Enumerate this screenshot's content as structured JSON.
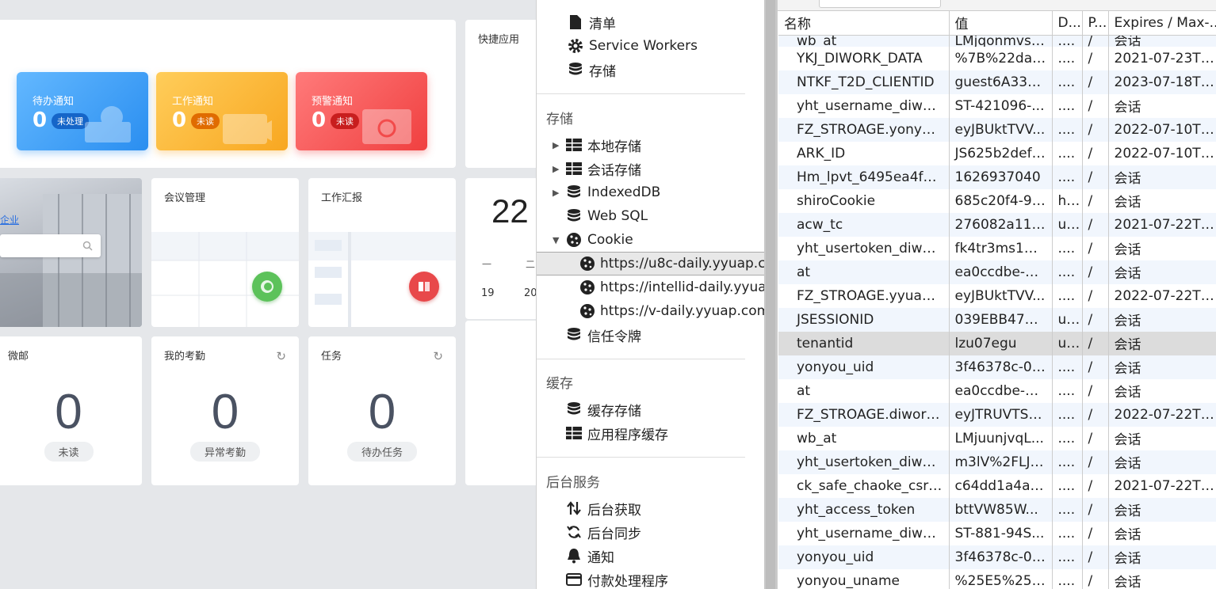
{
  "dashboard": {
    "quick_apps_title": "快捷应用",
    "notices": [
      {
        "title": "待办通知",
        "count": "0",
        "badge": "未处理"
      },
      {
        "title": "工作通知",
        "count": "0",
        "badge": "未读"
      },
      {
        "title": "预警通知",
        "count": "0",
        "badge": "未读"
      }
    ],
    "side_link": "企业",
    "meeting_title": "会议管理",
    "report_title": "工作汇报",
    "calendar": {
      "day": "22",
      "weekday_1": "一",
      "weekday_2": "二",
      "date_1": "19",
      "date_2": "20"
    },
    "mail": {
      "title": "微邮",
      "count": "0",
      "label": "未读"
    },
    "attendance": {
      "title": "我的考勤",
      "count": "0",
      "label": "异常考勤"
    },
    "tasks": {
      "title": "任务",
      "count": "0",
      "label": "待办任务"
    }
  },
  "devtools_sidebar": {
    "top_items": [
      {
        "label": "清单",
        "icon": "file-icon"
      },
      {
        "label": "Service Workers",
        "icon": "gear-icon"
      },
      {
        "label": "存储",
        "icon": "database-icon"
      }
    ],
    "storage_section": "存储",
    "storage_items": [
      {
        "label": "本地存储",
        "icon": "grid-icon"
      },
      {
        "label": "会话存储",
        "icon": "grid-icon"
      },
      {
        "label": "IndexedDB",
        "icon": "database-icon"
      },
      {
        "label": "Web SQL",
        "icon": "database-icon"
      },
      {
        "label": "Cookie",
        "icon": "cookie-icon"
      }
    ],
    "cookie_origins": [
      "https://u8c-daily.yyuap.com",
      "https://intellid-daily.yyuap.com",
      "https://v-daily.yyuap.com"
    ],
    "trust_tokens": "信任令牌",
    "cache_section": "缓存",
    "cache_items": [
      {
        "label": "缓存存储",
        "icon": "database-icon"
      },
      {
        "label": "应用程序缓存",
        "icon": "grid-icon"
      }
    ],
    "background_section": "后台服务",
    "background_items": [
      {
        "label": "后台获取",
        "icon": "fetch-arrows-icon"
      },
      {
        "label": "后台同步",
        "icon": "sync-icon"
      },
      {
        "label": "通知",
        "icon": "bell-icon"
      },
      {
        "label": "付款处理程序",
        "icon": "card-icon"
      }
    ]
  },
  "cookie_table": {
    "columns": [
      "名称",
      "值",
      "D...",
      "P...",
      "Expires / Max-..."
    ],
    "partial_row": {
      "name": "wb_at",
      "value": "LMjqonmvsj...",
      "domain": "....",
      "path": "/",
      "expires": "会话"
    },
    "rows": [
      {
        "name": "YKJ_DIWORK_DATA",
        "value": "%7B%22dat...",
        "domain": "....",
        "path": "/",
        "expires": "2021-07-23T0..."
      },
      {
        "name": "NTKF_T2D_CLIENTID",
        "value": "guest6A331...",
        "domain": "....",
        "path": "/",
        "expires": "2023-07-18T1..."
      },
      {
        "name": "yht_username_diwork",
        "value": "ST-421096-...",
        "domain": "....",
        "path": "/",
        "expires": "会话"
      },
      {
        "name": "FZ_STROAGE.yonyou....",
        "value": "eyJBUktTVV...",
        "domain": "....",
        "path": "/",
        "expires": "2022-07-10T0..."
      },
      {
        "name": "ARK_ID",
        "value": "JS625b2def4...",
        "domain": "....",
        "path": "/",
        "expires": "2022-07-10T0..."
      },
      {
        "name": "Hm_lpvt_6495ea4f6fb...",
        "value": "1626937040",
        "domain": "....",
        "path": "/",
        "expires": "会话"
      },
      {
        "name": "shiroCookie",
        "value": "685c20f4-92...",
        "domain": "h...",
        "path": "/",
        "expires": "会话"
      },
      {
        "name": "acw_tc",
        "value": "276082a116...",
        "domain": "u...",
        "path": "/",
        "expires": "2021-07-22T1..."
      },
      {
        "name": "yht_usertoken_diwork",
        "value": "fk4tr3ms1Siz...",
        "domain": "....",
        "path": "/",
        "expires": "会话"
      },
      {
        "name": "at",
        "value": "ea0ccdbe-5a...",
        "domain": "....",
        "path": "/",
        "expires": "会话"
      },
      {
        "name": "FZ_STROAGE.yyuap.c...",
        "value": "eyJBUktTVV...",
        "domain": "....",
        "path": "/",
        "expires": "2022-07-22T1..."
      },
      {
        "name": "JSESSIONID",
        "value": "039EBB4775...",
        "domain": "u...",
        "path": "/",
        "expires": "会话"
      },
      {
        "name": "tenantid",
        "value": "lzu07egu",
        "domain": "u...",
        "path": "/",
        "expires": "会话"
      },
      {
        "name": "yonyou_uid",
        "value": "3f46378c-0d...",
        "domain": "....",
        "path": "/",
        "expires": "会话"
      },
      {
        "name": "at",
        "value": "ea0ccdbe-5a...",
        "domain": "....",
        "path": "/",
        "expires": "会话"
      },
      {
        "name": "FZ_STROAGE.diwork.c...",
        "value": "eyJTRUVTSU...",
        "domain": "....",
        "path": "/",
        "expires": "2022-07-22T1..."
      },
      {
        "name": "wb_at",
        "value": "LMjuunjvqL...",
        "domain": "....",
        "path": "/",
        "expires": "会话"
      },
      {
        "name": "yht_usertoken_diwork",
        "value": "m3lV%2FLJq...",
        "domain": "....",
        "path": "/",
        "expires": "会话"
      },
      {
        "name": "ck_safe_chaoke_csrf_t...",
        "value": "c64dd1a4ac...",
        "domain": "....",
        "path": "/",
        "expires": "2021-07-22T1..."
      },
      {
        "name": "yht_access_token",
        "value": "bttVW85W...",
        "domain": "....",
        "path": "/",
        "expires": "会话"
      },
      {
        "name": "yht_username_diwork",
        "value": "ST-881-94S...",
        "domain": "....",
        "path": "/",
        "expires": "会话"
      },
      {
        "name": "yonyou_uid",
        "value": "3f46378c-0d...",
        "domain": "....",
        "path": "/",
        "expires": "会话"
      },
      {
        "name": "yonyou_uname",
        "value": "%25E5%258...",
        "domain": "....",
        "path": "/",
        "expires": "会话"
      }
    ]
  }
}
